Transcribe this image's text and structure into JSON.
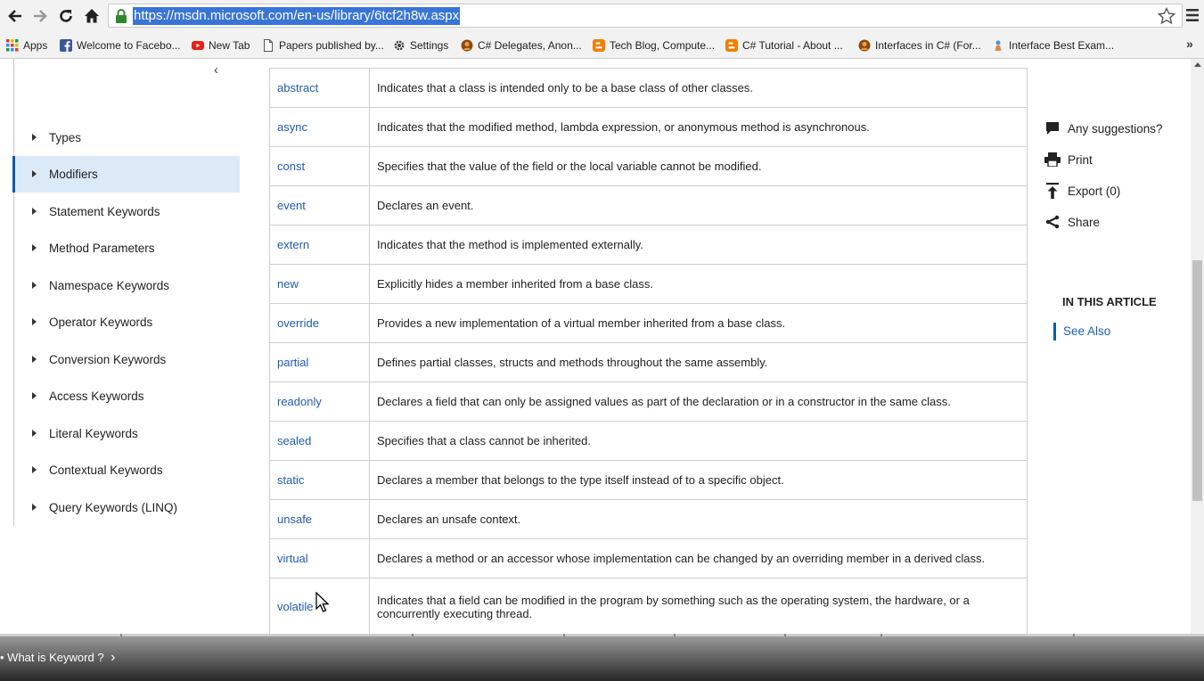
{
  "browser": {
    "url": "https://msdn.microsoft.com/en-us/library/6tcf2h8w.aspx",
    "bookmarks": [
      {
        "label": "Apps",
        "icon": "apps-grid-icon"
      },
      {
        "label": "Welcome to Facebo...",
        "icon": "facebook-icon"
      },
      {
        "label": "New Tab",
        "icon": "youtube-icon"
      },
      {
        "label": "Papers published by...",
        "icon": "page-icon"
      },
      {
        "label": "Settings",
        "icon": "gear-icon"
      },
      {
        "label": "C# Delegates, Anon...",
        "icon": "site-icon"
      },
      {
        "label": "Tech Blog, Compute...",
        "icon": "blogger-icon"
      },
      {
        "label": "C# Tutorial - About ...",
        "icon": "blogger-icon"
      },
      {
        "label": "Interfaces in C# (For...",
        "icon": "site-icon"
      },
      {
        "label": "Interface Best Exam...",
        "icon": "site-icon"
      }
    ],
    "more": "»"
  },
  "leftnav": {
    "collapse_glyph": "‹",
    "items": [
      {
        "label": "Types"
      },
      {
        "label": "Modifiers",
        "active": true
      },
      {
        "label": "Statement Keywords"
      },
      {
        "label": "Method Parameters"
      },
      {
        "label": "Namespace Keywords"
      },
      {
        "label": "Operator Keywords"
      },
      {
        "label": "Conversion Keywords"
      },
      {
        "label": "Access Keywords"
      },
      {
        "label": "Literal Keywords"
      },
      {
        "label": "Contextual Keywords"
      },
      {
        "label": "Query Keywords (LINQ)"
      }
    ]
  },
  "modifiers": [
    {
      "keyword": "abstract",
      "description": "Indicates that a class is intended only to be a base class of other classes."
    },
    {
      "keyword": "async",
      "description": "Indicates that the modified method, lambda expression, or anonymous method is asynchronous."
    },
    {
      "keyword": "const",
      "description": "Specifies that the value of the field or the local variable cannot be modified."
    },
    {
      "keyword": "event",
      "description": "Declares an event."
    },
    {
      "keyword": "extern",
      "description": "Indicates that the method is implemented externally."
    },
    {
      "keyword": "new",
      "description": "Explicitly hides a member inherited from a base class."
    },
    {
      "keyword": "override",
      "description": "Provides a new implementation of a virtual member inherited from a base class."
    },
    {
      "keyword": "partial",
      "description": "Defines partial classes, structs and methods throughout the same assembly."
    },
    {
      "keyword": "readonly",
      "description": "Declares a field that can only be assigned values as part of the declaration or in a constructor in the same class."
    },
    {
      "keyword": "sealed",
      "description": "Specifies that a class cannot be inherited."
    },
    {
      "keyword": "static",
      "description": "Declares a member that belongs to the type itself instead of to a specific object."
    },
    {
      "keyword": "unsafe",
      "description": "Declares an unsafe context."
    },
    {
      "keyword": "virtual",
      "description": "Declares a method or an accessor whose implementation can be changed by an overriding member in a derived class."
    },
    {
      "keyword": "volatile",
      "description": "Indicates that a field can be modified in the program by something such as the operating system, the hardware, or a concurrently executing thread."
    }
  ],
  "actions": {
    "suggestions": "Any suggestions?",
    "print": "Print",
    "export": "Export (0)",
    "share": "Share"
  },
  "article_nav": {
    "heading": "IN THIS ARTICLE",
    "link": "See Also"
  },
  "video": {
    "chapter": "What is Keyword ?",
    "chapter_glyph": "›"
  },
  "colors": {
    "link": "#1e5db4",
    "active_nav_bg": "#dce9f7",
    "url_highlight": "#3875d7"
  }
}
